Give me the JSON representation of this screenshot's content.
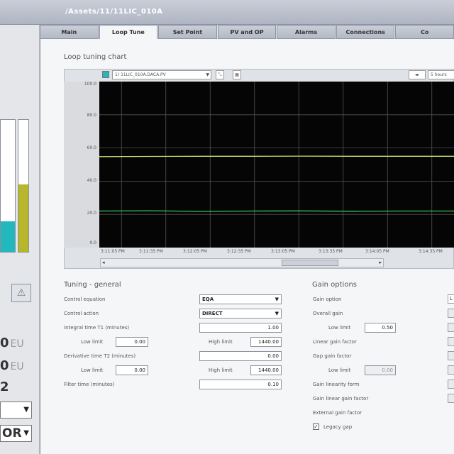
{
  "window": {
    "path": "/Assets/11/11LIC_010A"
  },
  "tabs": [
    {
      "label": "Main"
    },
    {
      "label": "Loop Tune"
    },
    {
      "label": "Set Point"
    },
    {
      "label": "PV and OP"
    },
    {
      "label": "Alarms"
    },
    {
      "label": "Connections"
    },
    {
      "label": "Co"
    }
  ],
  "left_panel": {
    "values": [
      {
        "value": "0",
        "unit": "EU"
      },
      {
        "value": "0",
        "unit": "EU"
      },
      {
        "value": "2"
      }
    ],
    "mode_dropdown": "OR",
    "bars": {
      "teal_level": 0.23,
      "yellow_level": 0.51
    },
    "colors": {
      "teal": "#22b8bd",
      "yellow": "#b8b62a"
    }
  },
  "chart": {
    "title": "Loop tuning chart",
    "pen_select": "1) 11LIC_010A.DACA.PV",
    "time_select": "5 hours",
    "pen_color": "#26b8b8",
    "y_ticks": [
      "100.0",
      "80.0",
      "60.0",
      "40.0",
      "20.0",
      "0.0"
    ],
    "x_ticks": [
      "3:11:05 PM",
      "3:11:35 PM",
      "3:12:05 PM",
      "3:12:35 PM",
      "3:13:05 PM",
      "3:13:35 PM",
      "3:14:05 PM",
      "3:14:35 PM"
    ]
  },
  "chart_data": {
    "type": "line",
    "title": "Loop tuning chart",
    "xlabel": "",
    "ylabel": "",
    "ylim": [
      0,
      100
    ],
    "x": [
      "3:11:05 PM",
      "3:11:35 PM",
      "3:12:05 PM",
      "3:12:35 PM",
      "3:13:05 PM",
      "3:13:35 PM",
      "3:14:05 PM",
      "3:14:35 PM"
    ],
    "series": [
      {
        "color": "#c8e070",
        "values": [
          54.8,
          54.9,
          55.0,
          55.0,
          55.1,
          55.0,
          55.0,
          55.0
        ]
      },
      {
        "color": "#38c858",
        "values": [
          22.0,
          22.2,
          21.8,
          22.0,
          22.1,
          21.9,
          22.0,
          22.0
        ]
      }
    ],
    "grid": true,
    "background": "#050505"
  },
  "tuning": {
    "title": "Tuning - general",
    "control_equation_label": "Control equation",
    "control_equation_value": "EQA",
    "control_action_label": "Control action",
    "control_action_value": "DIRECT",
    "integral_time_label": "Integral time T1 (minutes)",
    "integral_time_value": "1.00",
    "low_limit_label": "Low limit",
    "high_limit_label": "High limit",
    "integral_low": "0.00",
    "integral_high": "1440.00",
    "derivative_time_label": "Derivative time T2 (minutes)",
    "derivative_time_value": "0.00",
    "derivative_low": "0.00",
    "derivative_high": "1440.00",
    "filter_time_label": "Filter time (minutes)",
    "filter_time_value": "0.10"
  },
  "gain": {
    "title": "Gain options",
    "gain_option_label": "Gain option",
    "overall_gain_label": "Overall gain",
    "low_limit_label": "Low limit",
    "low_limit_value": "0.50",
    "linear_gain_factor_label": "Linear gain factor",
    "gap_gain_factor_label": "Gap gain factor",
    "gap_low_limit_label": "Low limit",
    "gap_low_limit_value": "0.00",
    "nonlinearity_form_label": "Gain linearity form",
    "nonlinear_gain_factor_label": "Gain linear gain factor",
    "external_gain_factor_label": "External gain factor",
    "legacy_gap_label": "Legacy gap",
    "legacy_gap_checked": true
  }
}
